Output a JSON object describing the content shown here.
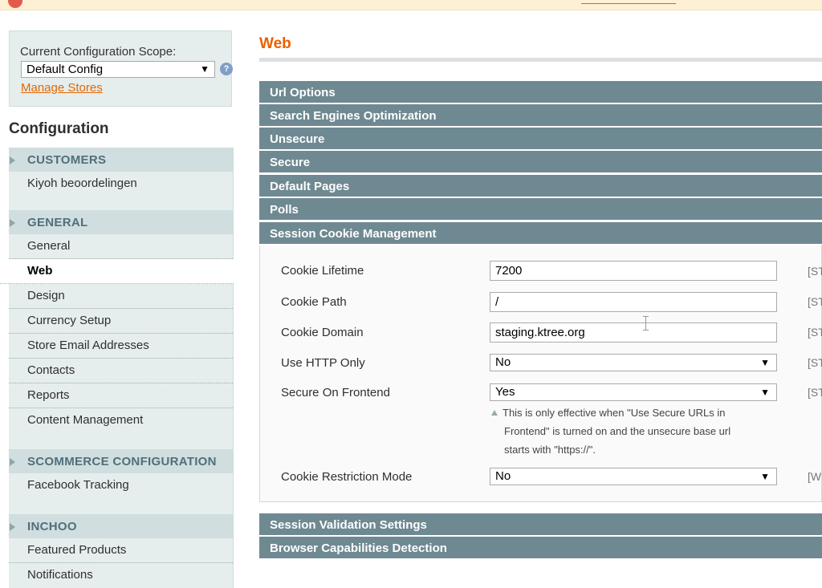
{
  "scope": {
    "label": "Current Configuration Scope:",
    "selected": "Default Config",
    "manage_link": "Manage Stores"
  },
  "sidebar": {
    "title": "Configuration",
    "groups": [
      {
        "title": "CUSTOMERS",
        "items": [
          "Kiyoh beoordelingen"
        ]
      },
      {
        "title": "GENERAL",
        "items": [
          "General",
          "Web",
          "Design",
          "Currency Setup",
          "Store Email Addresses",
          "Contacts",
          "Reports",
          "Content Management"
        ]
      },
      {
        "title": "SCOMMERCE CONFIGURATION",
        "items": [
          "Facebook Tracking"
        ]
      },
      {
        "title": "INCHOO",
        "items": [
          "Featured Products",
          "Notifications"
        ]
      }
    ],
    "active_item": "Web"
  },
  "main": {
    "title": "Web",
    "sections": [
      "Url Options",
      "Search Engines Optimization",
      "Unsecure",
      "Secure",
      "Default Pages",
      "Polls",
      "Session Cookie Management"
    ],
    "bottom_sections": [
      "Session Validation Settings",
      "Browser Capabilities Detection"
    ],
    "fields": {
      "cookie_lifetime": {
        "label": "Cookie Lifetime",
        "value": "7200",
        "scope": "[ST"
      },
      "cookie_path": {
        "label": "Cookie Path",
        "value": "/",
        "scope": "[ST"
      },
      "cookie_domain": {
        "label": "Cookie Domain",
        "value": "staging.ktree.org",
        "scope": "[ST"
      },
      "http_only": {
        "label": "Use HTTP Only",
        "value": "No",
        "scope": "[ST"
      },
      "secure_frontend": {
        "label": "Secure On Frontend",
        "value": "Yes",
        "scope": "[ST"
      },
      "restriction_mode": {
        "label": "Cookie Restriction Mode",
        "value": "No",
        "scope": "[W"
      }
    },
    "note": {
      "line1": "This is only effective when \"Use Secure URLs in",
      "line2": "Frontend\" is turned on and the unsecure base url",
      "line3": "starts with \"https://\"."
    }
  },
  "colors": {
    "accent": "#eb5e00",
    "link": "#e26703",
    "section_bar": "#6f8992",
    "sidebar_bg": "#e6eded",
    "sidebar_header": "#d1dedf"
  }
}
